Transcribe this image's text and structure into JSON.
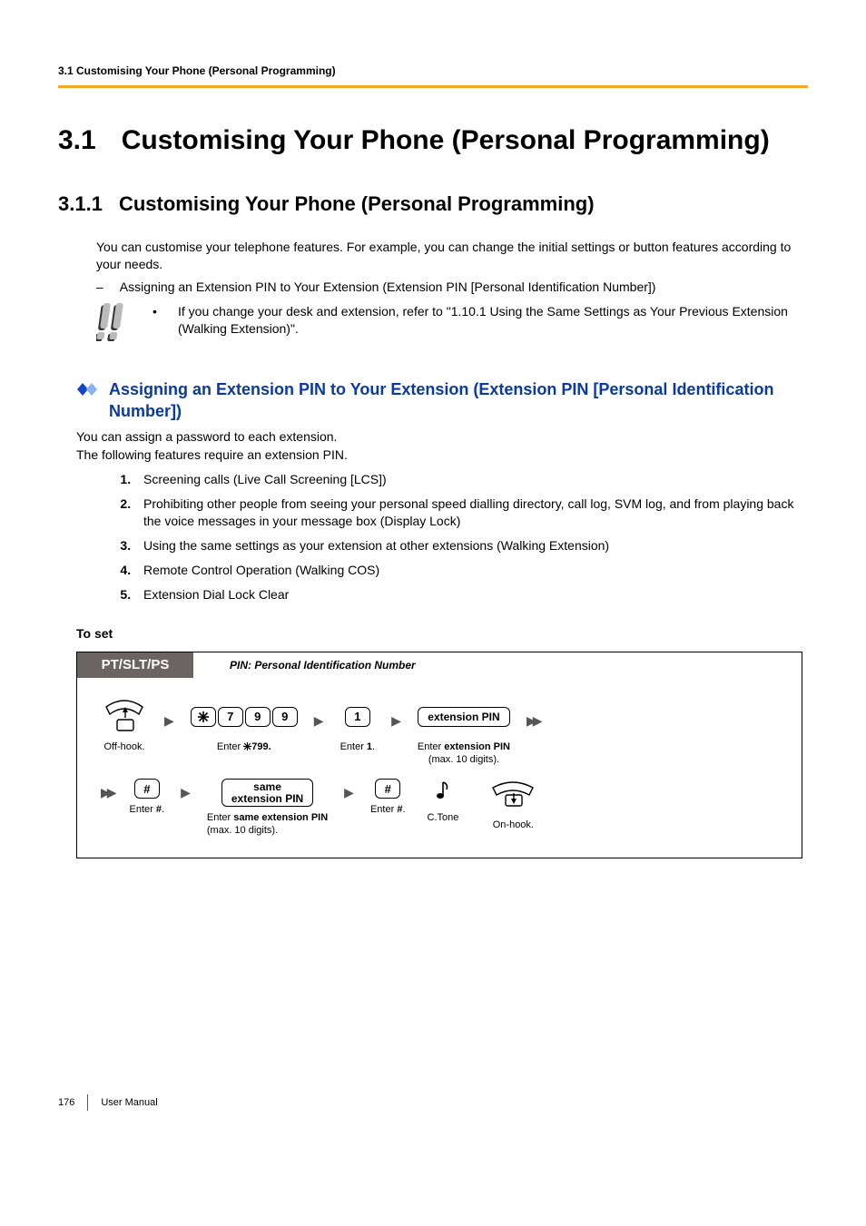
{
  "header": {
    "running": "3.1 Customising Your Phone (Personal Programming)"
  },
  "title": {
    "num": "3.1",
    "text": "Customising Your Phone (Personal Programming)"
  },
  "subsection": {
    "num": "3.1.1",
    "text": "Customising Your Phone (Personal Programming)"
  },
  "intro": "You can customise your telephone features. For example, you can change the initial settings or button features according to your needs.",
  "dash": {
    "mark": "–",
    "text": "Assigning an Extension PIN to Your Extension (Extension PIN [Personal Identification Number])"
  },
  "note": {
    "bullet": "•",
    "text": "If you change your desk and extension, refer to \"1.10.1 Using the Same Settings as Your Previous Extension (Walking Extension)\"."
  },
  "assign": {
    "heading": "Assigning an Extension PIN to Your Extension (Extension PIN [Personal Identification Number])",
    "line1": "You can assign a password to each extension.",
    "line2": "The following features require an extension PIN.",
    "items": [
      "Screening calls (Live Call Screening [LCS])",
      "Prohibiting other people from seeing your personal speed dialling directory, call log, SVM log, and from playing back the voice messages in your message box (Display Lock)",
      "Using the same settings as your extension at other extensions (Walking Extension)",
      "Remote Control Operation (Walking COS)",
      "Extension Dial Lock Clear"
    ]
  },
  "toset": "To set",
  "panel": {
    "badge": "PT/SLT/PS",
    "pin_expand": "PIN: Personal Identification Number",
    "row1": {
      "offhook": "Off-hook.",
      "keys": [
        "7",
        "9",
        "9"
      ],
      "enter799_1": "Enter ",
      "enter799_2": "799.",
      "one_key": "1",
      "enter1_1": "Enter ",
      "enter1_2": "1",
      "enter1_3": ".",
      "ext_pin_key": "extension PIN",
      "ext_pin_cap_1": "Enter ",
      "ext_pin_cap_2": "extension PIN",
      "ext_pin_cap_3": "(max. 10 digits)."
    },
    "row2": {
      "hash_key": "#",
      "enter_hash_1": "Enter ",
      "enter_hash_2": "#",
      "enter_hash_3": ".",
      "same_key_l1": "same",
      "same_key_l2": "extension PIN",
      "same_cap_1": "Enter ",
      "same_cap_2": "same extension PIN",
      "same_cap_3": "(max. 10 digits).",
      "hash2_key": "#",
      "enter_hash2_1": "Enter ",
      "enter_hash2_2": "#",
      "enter_hash2_3": ".",
      "ctone": "C.Tone",
      "onhook": "On-hook."
    }
  },
  "footer": {
    "page": "176",
    "label": "User Manual"
  }
}
